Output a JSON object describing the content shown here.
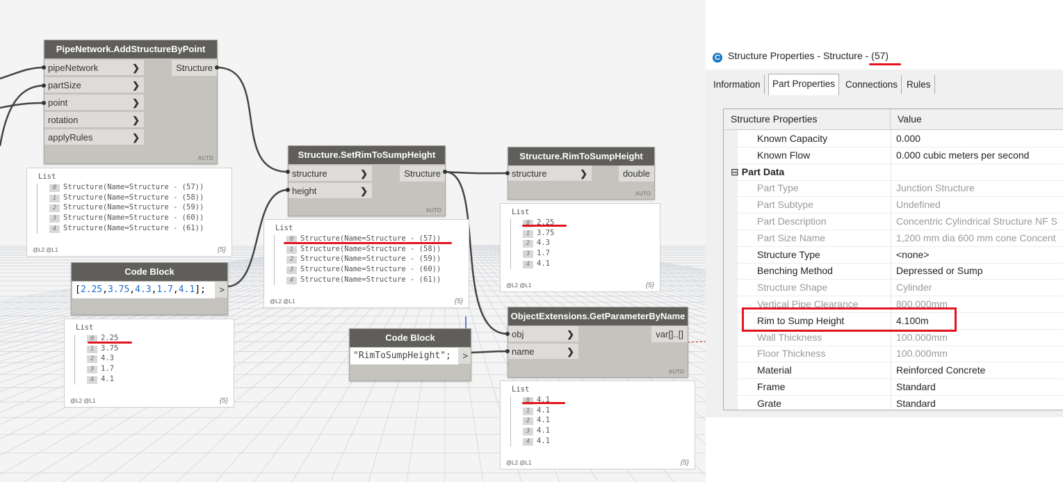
{
  "nodes": {
    "add_structure": {
      "title": "PipeNetwork.AddStructureByPoint",
      "inputs": [
        "pipeNetwork",
        "partSize",
        "point",
        "rotation",
        "applyRules"
      ],
      "output": "Structure",
      "lacing": "AUTO",
      "preview": {
        "header": "List",
        "rows": [
          {
            "i": "0",
            "v": "Structure(Name=Structure - (57))"
          },
          {
            "i": "1",
            "v": "Structure(Name=Structure - (58))"
          },
          {
            "i": "2",
            "v": "Structure(Name=Structure - (59))"
          },
          {
            "i": "3",
            "v": "Structure(Name=Structure - (60))"
          },
          {
            "i": "4",
            "v": "Structure(Name=Structure - (61))"
          }
        ],
        "levels": "@L2 @L1",
        "count": "{5}"
      }
    },
    "code_block_1": {
      "title": "Code Block",
      "code_open": "[",
      "code_values": [
        "2.25",
        "3.75",
        "4.3",
        "1.7",
        "4.1"
      ],
      "code_close": "];",
      "output_symbol": ">",
      "preview": {
        "header": "List",
        "rows": [
          {
            "i": "0",
            "v": "2.25"
          },
          {
            "i": "1",
            "v": "3.75"
          },
          {
            "i": "2",
            "v": "4.3"
          },
          {
            "i": "3",
            "v": "1.7"
          },
          {
            "i": "4",
            "v": "4.1"
          }
        ],
        "levels": "@L2 @L1",
        "count": "{5}"
      }
    },
    "set_rim": {
      "title": "Structure.SetRimToSumpHeight",
      "inputs": [
        "structure",
        "height"
      ],
      "output": "Structure",
      "lacing": "AUTO",
      "preview": {
        "header": "List",
        "rows": [
          {
            "i": "0",
            "v": "Structure(Name=Structure - (57))"
          },
          {
            "i": "1",
            "v": "Structure(Name=Structure - (58))"
          },
          {
            "i": "2",
            "v": "Structure(Name=Structure - (59))"
          },
          {
            "i": "3",
            "v": "Structure(Name=Structure - (60))"
          },
          {
            "i": "4",
            "v": "Structure(Name=Structure - (61))"
          }
        ],
        "levels": "@L2 @L1",
        "count": "{5}"
      }
    },
    "rim_to_sump": {
      "title": "Structure.RimToSumpHeight",
      "inputs": [
        "structure"
      ],
      "output": "double",
      "lacing": "AUTO",
      "preview": {
        "header": "List",
        "rows": [
          {
            "i": "0",
            "v": "2.25"
          },
          {
            "i": "1",
            "v": "3.75"
          },
          {
            "i": "2",
            "v": "4.3"
          },
          {
            "i": "3",
            "v": "1.7"
          },
          {
            "i": "4",
            "v": "4.1"
          }
        ],
        "levels": "@L2 @L1",
        "count": "{5}"
      }
    },
    "code_block_2": {
      "title": "Code Block",
      "code": "\"RimToSumpHeight\";",
      "output_symbol": ">"
    },
    "get_param": {
      "title": "ObjectExtensions.GetParameterByName",
      "inputs": [
        "obj",
        "name"
      ],
      "output": "var[]..[]",
      "lacing": "AUTO",
      "preview": {
        "header": "List",
        "rows": [
          {
            "i": "0",
            "v": "4.1"
          },
          {
            "i": "1",
            "v": "4.1"
          },
          {
            "i": "2",
            "v": "4.1"
          },
          {
            "i": "3",
            "v": "4.1"
          },
          {
            "i": "4",
            "v": "4.1"
          }
        ],
        "levels": "@L2 @L1",
        "count": "{5}"
      }
    }
  },
  "properties": {
    "title": "Structure Properties - Structure - (57)",
    "app_icon": "C",
    "tabs": [
      "Information",
      "Part Properties",
      "Connections",
      "Rules"
    ],
    "active_tab": "Part Properties",
    "columns": [
      "Structure Properties",
      "Value"
    ],
    "rows": [
      {
        "name": "Known Capacity",
        "value": "0.000",
        "state": "normal"
      },
      {
        "name": "Known Flow",
        "value": "0.000 cubic meters per second",
        "state": "normal"
      },
      {
        "name": "Part Data",
        "value": "",
        "state": "group",
        "toggle": "⊟"
      },
      {
        "name": "Part Type",
        "value": "Junction Structure",
        "state": "readonly"
      },
      {
        "name": "Part Subtype",
        "value": "Undefined",
        "state": "readonly"
      },
      {
        "name": "Part Description",
        "value": "Concentric Cylindrical Structure NF S",
        "state": "readonly"
      },
      {
        "name": "Part Size Name",
        "value": "1,200 mm dia 600 mm cone Concent",
        "state": "readonly"
      },
      {
        "name": "Structure Type",
        "value": "<none>",
        "state": "normal"
      },
      {
        "name": "Benching Method",
        "value": "Depressed or Sump",
        "state": "normal"
      },
      {
        "name": "Structure Shape",
        "value": "Cylinder",
        "state": "readonly"
      },
      {
        "name": "Vertical Pipe Clearance",
        "value": "800.000mm",
        "state": "readonly"
      },
      {
        "name": "Rim to Sump Height",
        "value": "4.100m",
        "state": "normal"
      },
      {
        "name": "Wall Thickness",
        "value": "100.000mm",
        "state": "readonly"
      },
      {
        "name": "Floor Thickness",
        "value": "100.000mm",
        "state": "readonly"
      },
      {
        "name": "Material",
        "value": "Reinforced Concrete",
        "state": "normal"
      },
      {
        "name": "Frame",
        "value": "Standard",
        "state": "normal"
      },
      {
        "name": "Grate",
        "value": "Standard",
        "state": "normal"
      }
    ]
  },
  "colors": {
    "node_header": "#5f5e5b",
    "node_body": "#c5c3bd",
    "highlight_red": "#e3141e",
    "number_blue": "#1a6fd1",
    "readonly_text": "#9a9a9a"
  }
}
